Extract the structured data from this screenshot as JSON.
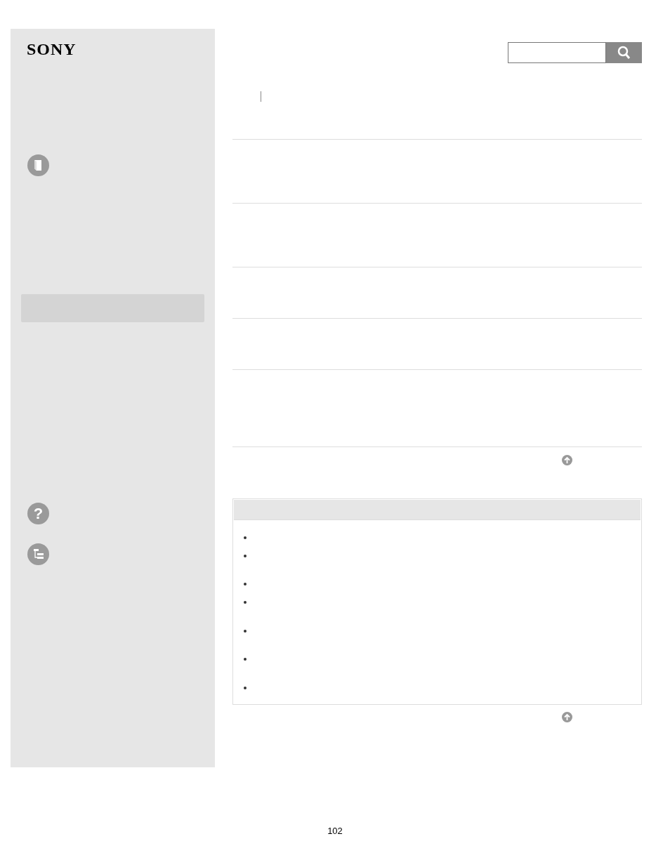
{
  "logo": {
    "text": "SONY"
  },
  "sidebar": {
    "help_icon_glyph": "?"
  },
  "footer": {
    "page_number": "102"
  }
}
